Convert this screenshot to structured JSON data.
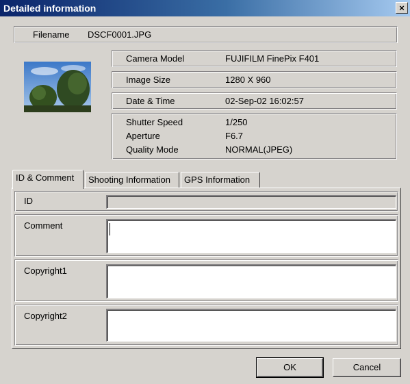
{
  "window": {
    "title": "Detailed information",
    "close_glyph": "×"
  },
  "file": {
    "label": "Filename",
    "value": "DSCF0001.JPG"
  },
  "info": {
    "camera_model": {
      "label": "Camera Model",
      "value": "FUJIFILM FinePix F401"
    },
    "image_size": {
      "label": "Image Size",
      "value": "1280 X 960"
    },
    "date_time": {
      "label": "Date & Time",
      "value": "02-Sep-02 16:02:57"
    },
    "shutter_speed": {
      "label": "Shutter Speed",
      "value": "1/250"
    },
    "aperture": {
      "label": "Aperture",
      "value": "F6.7"
    },
    "quality_mode": {
      "label": "Quality Mode",
      "value": "NORMAL(JPEG)"
    }
  },
  "tabs": [
    {
      "label": "ID & Comment",
      "active": true
    },
    {
      "label": "Shooting Information",
      "active": false
    },
    {
      "label": "GPS Information",
      "active": false
    }
  ],
  "fields": {
    "id": {
      "label": "ID",
      "value": ""
    },
    "comment": {
      "label": "Comment",
      "value": ""
    },
    "copyright1": {
      "label": "Copyright1",
      "value": ""
    },
    "copyright2": {
      "label": "Copyright2",
      "value": ""
    }
  },
  "buttons": {
    "ok": "OK",
    "cancel": "Cancel"
  },
  "thumbnail": {
    "icon": "photo-thumbnail-trees-sky"
  },
  "colors": {
    "titlebar_start": "#0a246a",
    "titlebar_end": "#a6caf0",
    "face": "#d6d3ce"
  }
}
